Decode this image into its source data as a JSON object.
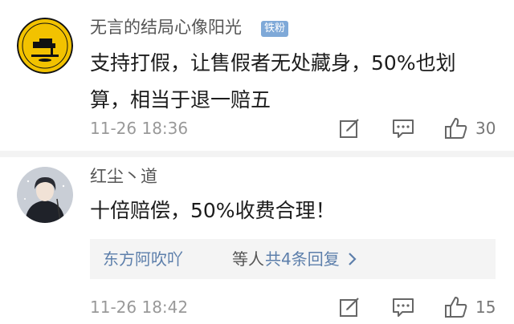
{
  "comments": [
    {
      "username": "无言的结局心像阳光",
      "badge": "铁粉",
      "content": "支持打假，让售假者无处藏身，50%也划算，相当于退一赔五",
      "timestamp": "11-26 18:36",
      "likes": "30",
      "avatar_icon": "sewing-machine-logo"
    },
    {
      "username": "红尘丶道",
      "content": "十倍赔偿，50%收费合理！",
      "timestamp": "11-26 18:42",
      "likes": "15",
      "avatar_icon": "person-portrait",
      "replies": {
        "users": "东方阿吹吖",
        "suffix": "等人",
        "count_text": "共4条回复"
      }
    }
  ],
  "colors": {
    "link": "#5d7fab",
    "badge": "#7fa9d8",
    "meta": "#999999",
    "divider": "#f3f3f3"
  }
}
